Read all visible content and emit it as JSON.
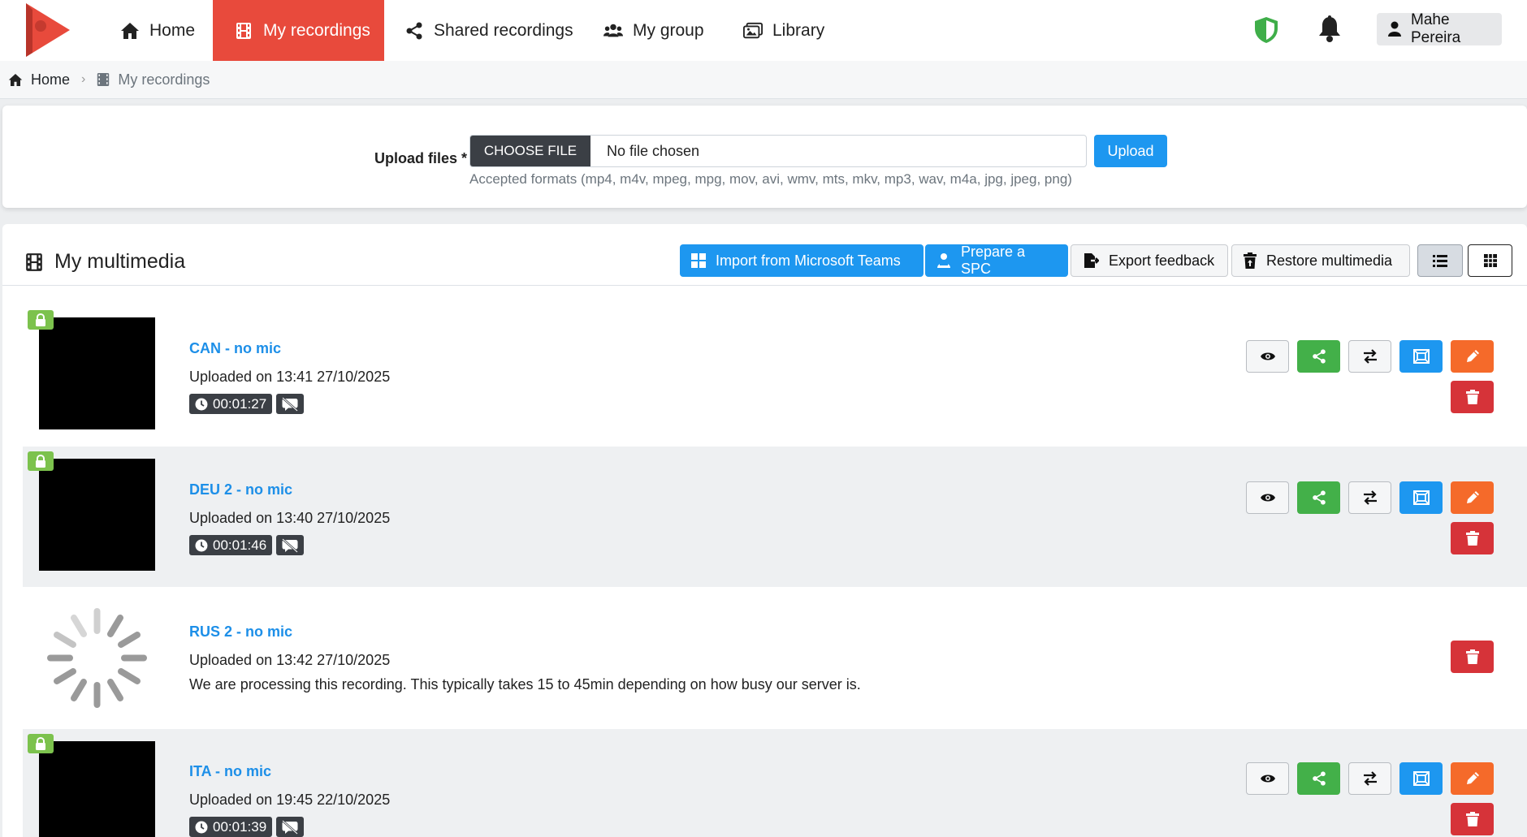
{
  "nav": {
    "items": [
      {
        "label": "Home",
        "icon": "home-icon"
      },
      {
        "label": "My recordings",
        "icon": "film-icon",
        "active": true
      },
      {
        "label": "Shared recordings",
        "icon": "share-icon"
      },
      {
        "label": "My group",
        "icon": "users-icon"
      },
      {
        "label": "Library",
        "icon": "images-icon"
      }
    ],
    "user_name": "Mahe Pereira"
  },
  "breadcrumb": {
    "home": "Home",
    "current": "My recordings"
  },
  "upload": {
    "label": "Upload files *",
    "choose_label": "CHOOSE FILE",
    "file_name": "No file chosen",
    "upload_label": "Upload",
    "formats": "Accepted formats (mp4, m4v, mpeg, mpg, mov, avi, wmv, mts, mkv, mp3, wav, m4a, jpg, jpeg, png)"
  },
  "media": {
    "title": "My multimedia",
    "buttons": {
      "import_teams": "Import from Microsoft Teams",
      "prepare_spc": "Prepare a SPC",
      "export_feedback": "Export feedback",
      "restore": "Restore multimedia"
    },
    "recordings": [
      {
        "title": "CAN - no mic",
        "uploaded": "Uploaded on 13:41 27/10/2025",
        "duration": "00:01:27"
      },
      {
        "title": "DEU 2 - no mic",
        "uploaded": "Uploaded on 13:40 27/10/2025",
        "duration": "00:01:46"
      },
      {
        "title": "RUS 2 - no mic",
        "uploaded": "Uploaded on 13:42 27/10/2025",
        "note": "We are processing this recording. This typically takes 15 to 45min depending on how busy our server is."
      },
      {
        "title": "ITA - no mic",
        "uploaded": "Uploaded on 19:45 22/10/2025",
        "duration": "00:01:39"
      }
    ]
  },
  "colors": {
    "accent_red": "#e84a3c",
    "primary_blue": "#1d97f0",
    "success_green": "#43b049",
    "warning_orange": "#f56a2a",
    "danger_red": "#d63339",
    "lock_green": "#7cc24d"
  }
}
